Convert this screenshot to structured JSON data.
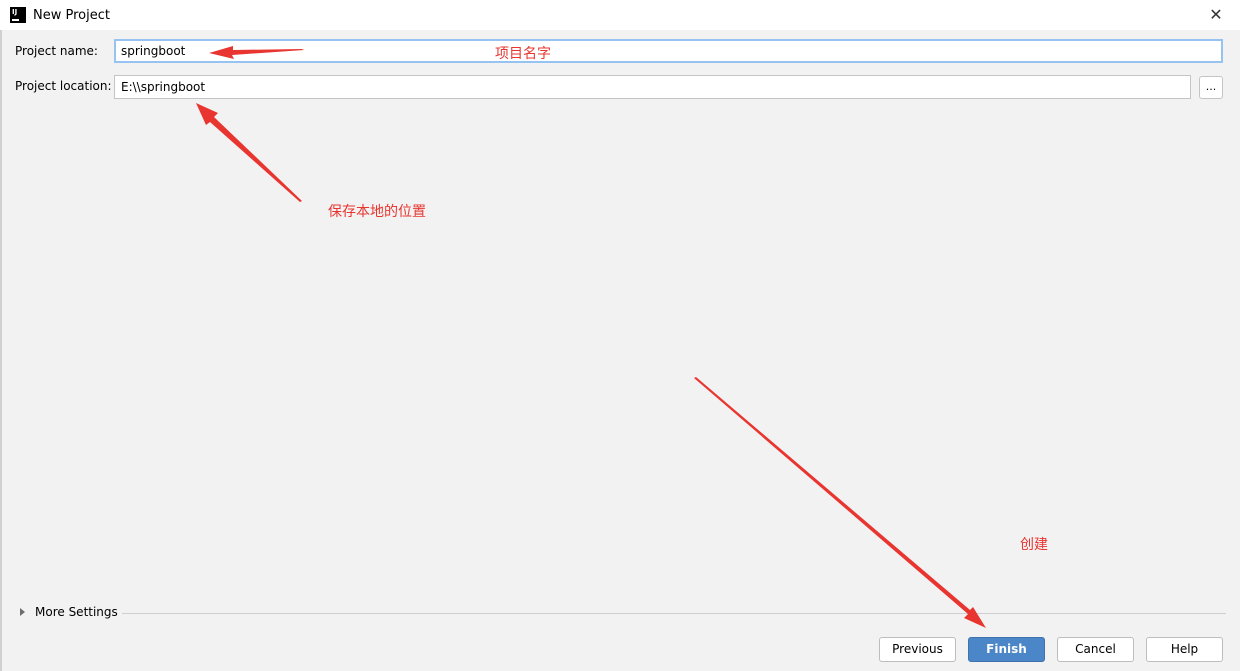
{
  "window": {
    "title": "New Project",
    "close_glyph": "✕",
    "icon": "intellij-idea-icon"
  },
  "form": {
    "project_name": {
      "label": "Project name:",
      "value": "springboot"
    },
    "project_location": {
      "label": "Project location:",
      "value": "E:\\\\springboot",
      "browse_label": "..."
    }
  },
  "more_settings": {
    "label": "More Settings",
    "expanded": false
  },
  "buttons": {
    "previous": "Previous",
    "finish": "Finish",
    "cancel": "Cancel",
    "help": "Help"
  },
  "annotations": {
    "name": "项目名字",
    "location": "保存本地的位置",
    "create": "创建",
    "color": "#e8352f"
  },
  "colors": {
    "primary_button": "#4a86c8",
    "focus_border": "#97c3f3"
  }
}
